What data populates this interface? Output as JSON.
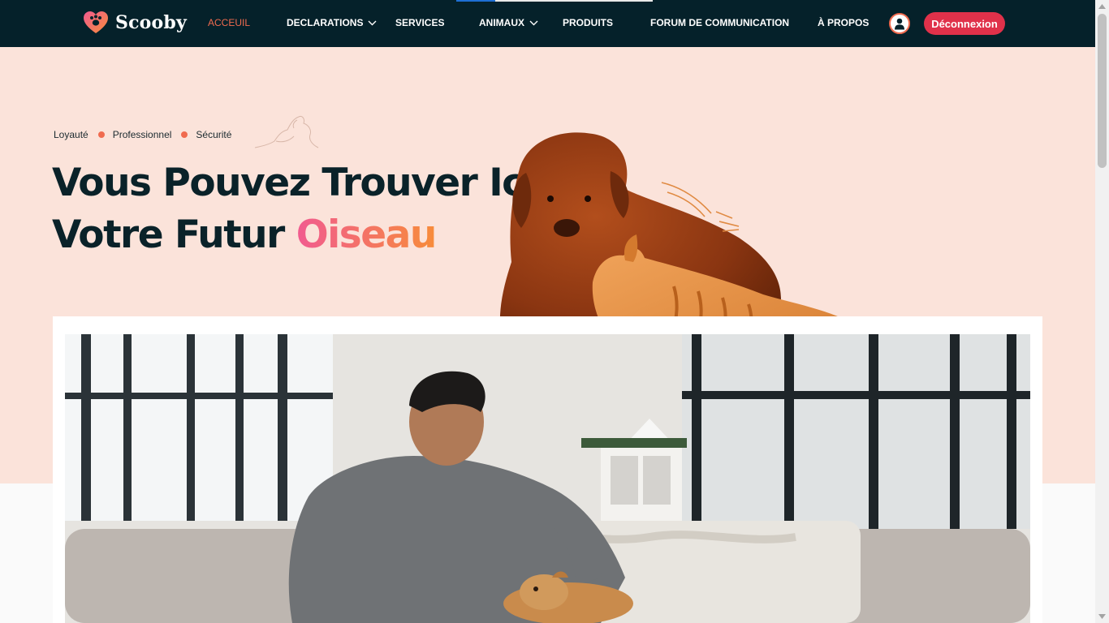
{
  "brand": {
    "name": "Scooby",
    "logo_icon": "heart-paw-icon"
  },
  "nav": {
    "items": [
      {
        "label": "ACCEUIL",
        "active": true
      },
      {
        "label": "DECLARATIONS",
        "dropdown": true
      },
      {
        "label": "SERVICES"
      },
      {
        "label": "ANIMAUX",
        "dropdown": true
      },
      {
        "label": "PRODUITS"
      },
      {
        "label": "FORUM DE COMMUNICATION"
      },
      {
        "label": "À PROPOS"
      }
    ],
    "user_icon": "user-icon",
    "logout_label": "Déconnexion"
  },
  "hero": {
    "tags": [
      "Loyauté",
      "Professionnel",
      "Sécurité"
    ],
    "headline_line1": "Vous Pouvez Trouver Ici",
    "headline_line2_prefix": "Votre Futur ",
    "headline_accent": "Oiseau"
  },
  "colors": {
    "nav_bg": "#05212a",
    "accent": "#f06b4f",
    "logout": "#e0314a",
    "hero_bg": "#fbe3da",
    "gradient_start": "#f15b90",
    "gradient_end": "#f78c3a"
  }
}
